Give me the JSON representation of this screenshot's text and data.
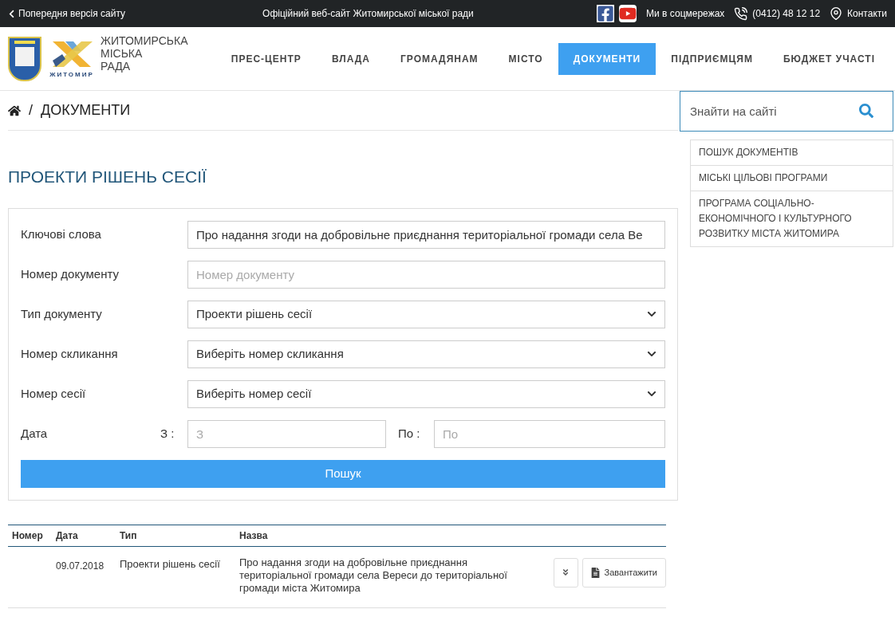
{
  "top_bar": {
    "back_link": "Попередня версія сайту",
    "title": "Офіційний веб-сайт Житомирської міської ради",
    "social": "Ми в соцмережах",
    "phone": "(0412) 48 12 12",
    "contacts": "Контакти"
  },
  "logo": {
    "city_name": "ЖИТОМИР",
    "name_lines": [
      "ЖИТОМИРСЬКА",
      "МІСЬКА",
      "РАДА"
    ]
  },
  "nav": [
    {
      "label": "ПРЕС-ЦЕНТР",
      "selected": false
    },
    {
      "label": "ВЛАДА",
      "selected": false
    },
    {
      "label": "ГРОМАДЯНАМ",
      "selected": false
    },
    {
      "label": "МІСТО",
      "selected": false
    },
    {
      "label": "ДОКУМЕНТИ",
      "selected": true
    },
    {
      "label": "ПІДПРИЄМЦЯМ",
      "selected": false
    },
    {
      "label": "БЮДЖЕТ УЧАСТІ",
      "selected": false
    }
  ],
  "breadcrumb": {
    "separator": "/",
    "current": "ДОКУМЕНТИ"
  },
  "search": {
    "placeholder": "Знайти на сайті"
  },
  "side_menu": [
    "ПОШУК ДОКУМЕНТІВ",
    "МІСЬКІ ЦІЛЬОВІ ПРОГРАМИ",
    "ПРОГРАМА СОЦІАЛЬНО-ЕКОНОМІЧНОГО І КУЛЬТУРНОГО РОЗВИТКУ МІСТА ЖИТОМИРА"
  ],
  "heading": "ПРОЕКТИ РІШЕНЬ СЕСІЇ",
  "form": {
    "fields": [
      {
        "kind": "text",
        "label": "Ключові слова",
        "value": "Про надання згоди на добровільне приєднання територіальної громади села Ве"
      },
      {
        "kind": "text",
        "label": "Номер документу",
        "placeholder": "Номер документу"
      },
      {
        "kind": "select",
        "label": "Тип документу",
        "value": "Проекти рішень сесії"
      },
      {
        "kind": "select",
        "label": "Номер скликання",
        "value": "Виберіть номер скликання"
      },
      {
        "kind": "select",
        "label": "Номер сесії",
        "value": "Виберіть номер сесії"
      },
      {
        "kind": "daterange",
        "label": "Дата",
        "from_label": "З :",
        "from_placeholder": "З",
        "to_label": "По :",
        "to_placeholder": "По"
      }
    ],
    "submit": "Пошук"
  },
  "table": {
    "columns": [
      "Номер",
      "Дата",
      "Тип",
      "Назва"
    ],
    "rows": [
      {
        "number": "",
        "date": "09.07.2018",
        "type": "Проекти рішень сесії",
        "title": "Про надання згоди на добровільне приєднання територіальної громади села Вереси до територіальної громади міста Житомира",
        "download": "Завантажити"
      }
    ]
  }
}
